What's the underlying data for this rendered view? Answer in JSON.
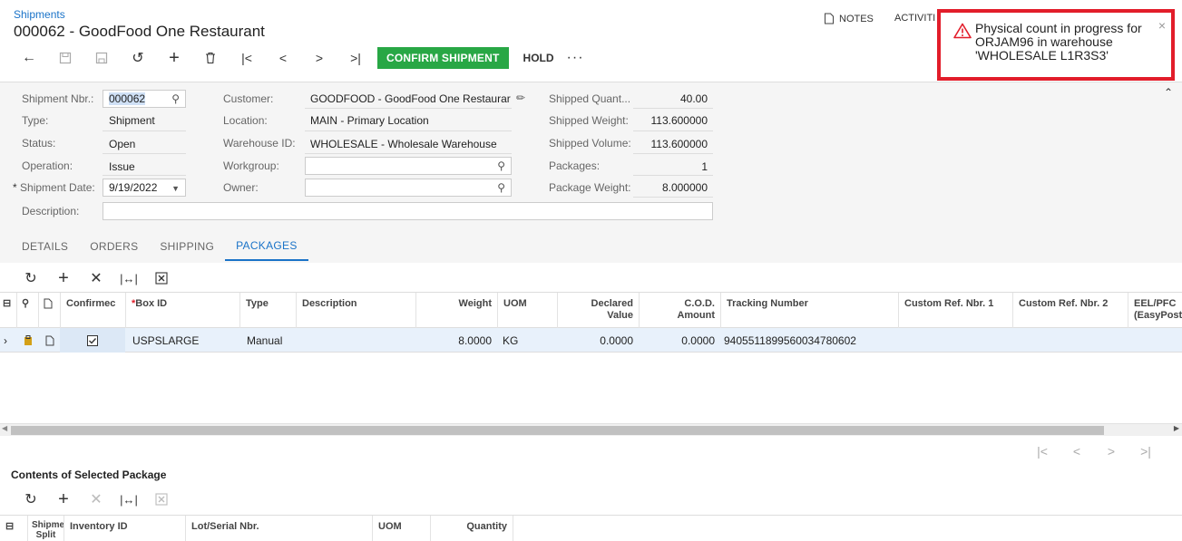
{
  "header": {
    "breadcrumb": "Shipments",
    "title": "000062 - GoodFood One Restaurant",
    "notes_label": "NOTES",
    "activities_label": "ACTIVITI",
    "toolbar": {
      "confirm_label": "CONFIRM SHIPMENT",
      "hold_label": "HOLD",
      "more_label": "···"
    }
  },
  "toast": {
    "message": "Physical count in progress for ORJAM96 in warehouse 'WHOLESALE L1R3S3'",
    "close_label": "×",
    "icon": "warning-triangle-icon",
    "border_color": "#e21d2a"
  },
  "form": {
    "shipment_nbr": {
      "label": "Shipment Nbr.:",
      "value": "000062"
    },
    "type": {
      "label": "Type:",
      "value": "Shipment"
    },
    "status": {
      "label": "Status:",
      "value": "Open"
    },
    "operation": {
      "label": "Operation:",
      "value": "Issue"
    },
    "shipment_date": {
      "label": "Shipment Date:",
      "value": "9/19/2022",
      "required_mark": "*"
    },
    "description": {
      "label": "Description:",
      "value": ""
    },
    "customer": {
      "label": "Customer:",
      "value": "GOODFOOD - GoodFood One Restaurar"
    },
    "location": {
      "label": "Location:",
      "value": "MAIN - Primary Location"
    },
    "warehouse": {
      "label": "Warehouse ID:",
      "value": "WHOLESALE - Wholesale Warehouse"
    },
    "workgroup": {
      "label": "Workgroup:",
      "value": ""
    },
    "owner": {
      "label": "Owner:",
      "value": ""
    },
    "shipped_quantity": {
      "label": "Shipped Quant...",
      "value": "40.00"
    },
    "shipped_weight": {
      "label": "Shipped Weight:",
      "value": "113.600000"
    },
    "shipped_volume": {
      "label": "Shipped Volume:",
      "value": "113.600000"
    },
    "packages": {
      "label": "Packages:",
      "value": "1"
    },
    "package_weight": {
      "label": "Package Weight:",
      "value": "8.000000"
    }
  },
  "tabs": [
    "DETAILS",
    "ORDERS",
    "SHIPPING",
    "PACKAGES"
  ],
  "active_tab": "PACKAGES",
  "packages_grid": {
    "columns": {
      "confirmed": "Confirmec",
      "box_id": "Box ID",
      "box_id_required": "*",
      "type": "Type",
      "description": "Description",
      "weight": "Weight",
      "uom": "UOM",
      "declared_value": "Declared Value",
      "cod_amount": "C.O.D. Amount",
      "tracking_number": "Tracking Number",
      "custom_ref_1": "Custom Ref. Nbr. 1",
      "custom_ref_2": "Custom Ref. Nbr. 2",
      "eel_pfc": "EEL/PFC (EasyPost"
    },
    "rows": [
      {
        "confirmed": true,
        "box_id": "USPSLARGE",
        "type": "Manual",
        "description": "",
        "weight": "8.0000",
        "uom": "KG",
        "declared_value": "0.0000",
        "cod_amount": "0.0000",
        "tracking_number": "9405511899560034780602"
      }
    ]
  },
  "contents": {
    "title": "Contents of Selected Package",
    "columns": {
      "shipment_split": "Shipmer Split",
      "inventory_id": "Inventory ID",
      "lot_serial": "Lot/Serial Nbr.",
      "uom": "UOM",
      "quantity": "Quantity"
    }
  },
  "colors": {
    "accent": "#1a73c8",
    "confirm_button": "#28a745",
    "selected_row": "#e8f1fb",
    "form_bg": "#f5f5f5"
  }
}
